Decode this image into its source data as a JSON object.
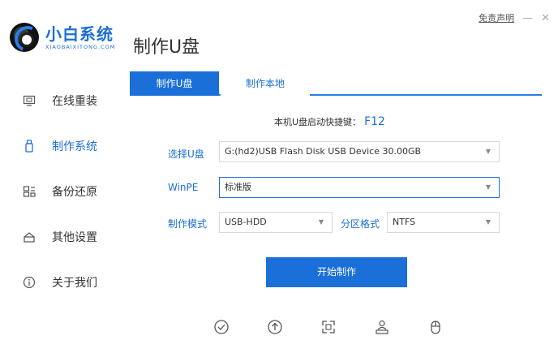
{
  "app": {
    "logo_cn": "小白系统",
    "logo_en": "XIAOBAIXITONG.COM",
    "page_title": "制作U盘"
  },
  "top_right": {
    "disclaimer": "免责声明",
    "minimize": "—",
    "close": "✕"
  },
  "sidebar": {
    "items": [
      {
        "label": "在线重装",
        "icon": "monitor-icon"
      },
      {
        "label": "制作系统",
        "icon": "usb-icon",
        "active": true
      },
      {
        "label": "备份还原",
        "icon": "backup-icon"
      },
      {
        "label": "其他设置",
        "icon": "settings-box-icon"
      },
      {
        "label": "关于我们",
        "icon": "info-icon"
      }
    ]
  },
  "tabs": [
    {
      "label": "制作U盘",
      "active": true
    },
    {
      "label": "制作本地",
      "active": false
    }
  ],
  "hotkey": {
    "label": "本机U盘启动快捷键：",
    "key": "F12"
  },
  "form": {
    "usb_label": "选择U盘",
    "usb_value": "G:(hd2)USB Flash Disk USB Device 30.00GB",
    "winpe_label": "WinPE",
    "winpe_value": "标准版",
    "mode_label": "制作模式",
    "mode_value": "USB-HDD",
    "partition_label": "分区格式",
    "partition_value": "NTFS"
  },
  "start_button": "开始制作",
  "bottom_icons": [
    "check-circle-icon",
    "upload-circle-icon",
    "expand-icon",
    "user-network-icon",
    "mouse-icon"
  ],
  "colors": {
    "accent": "#1a6fd8",
    "tab_line": "#2a7ee8"
  }
}
